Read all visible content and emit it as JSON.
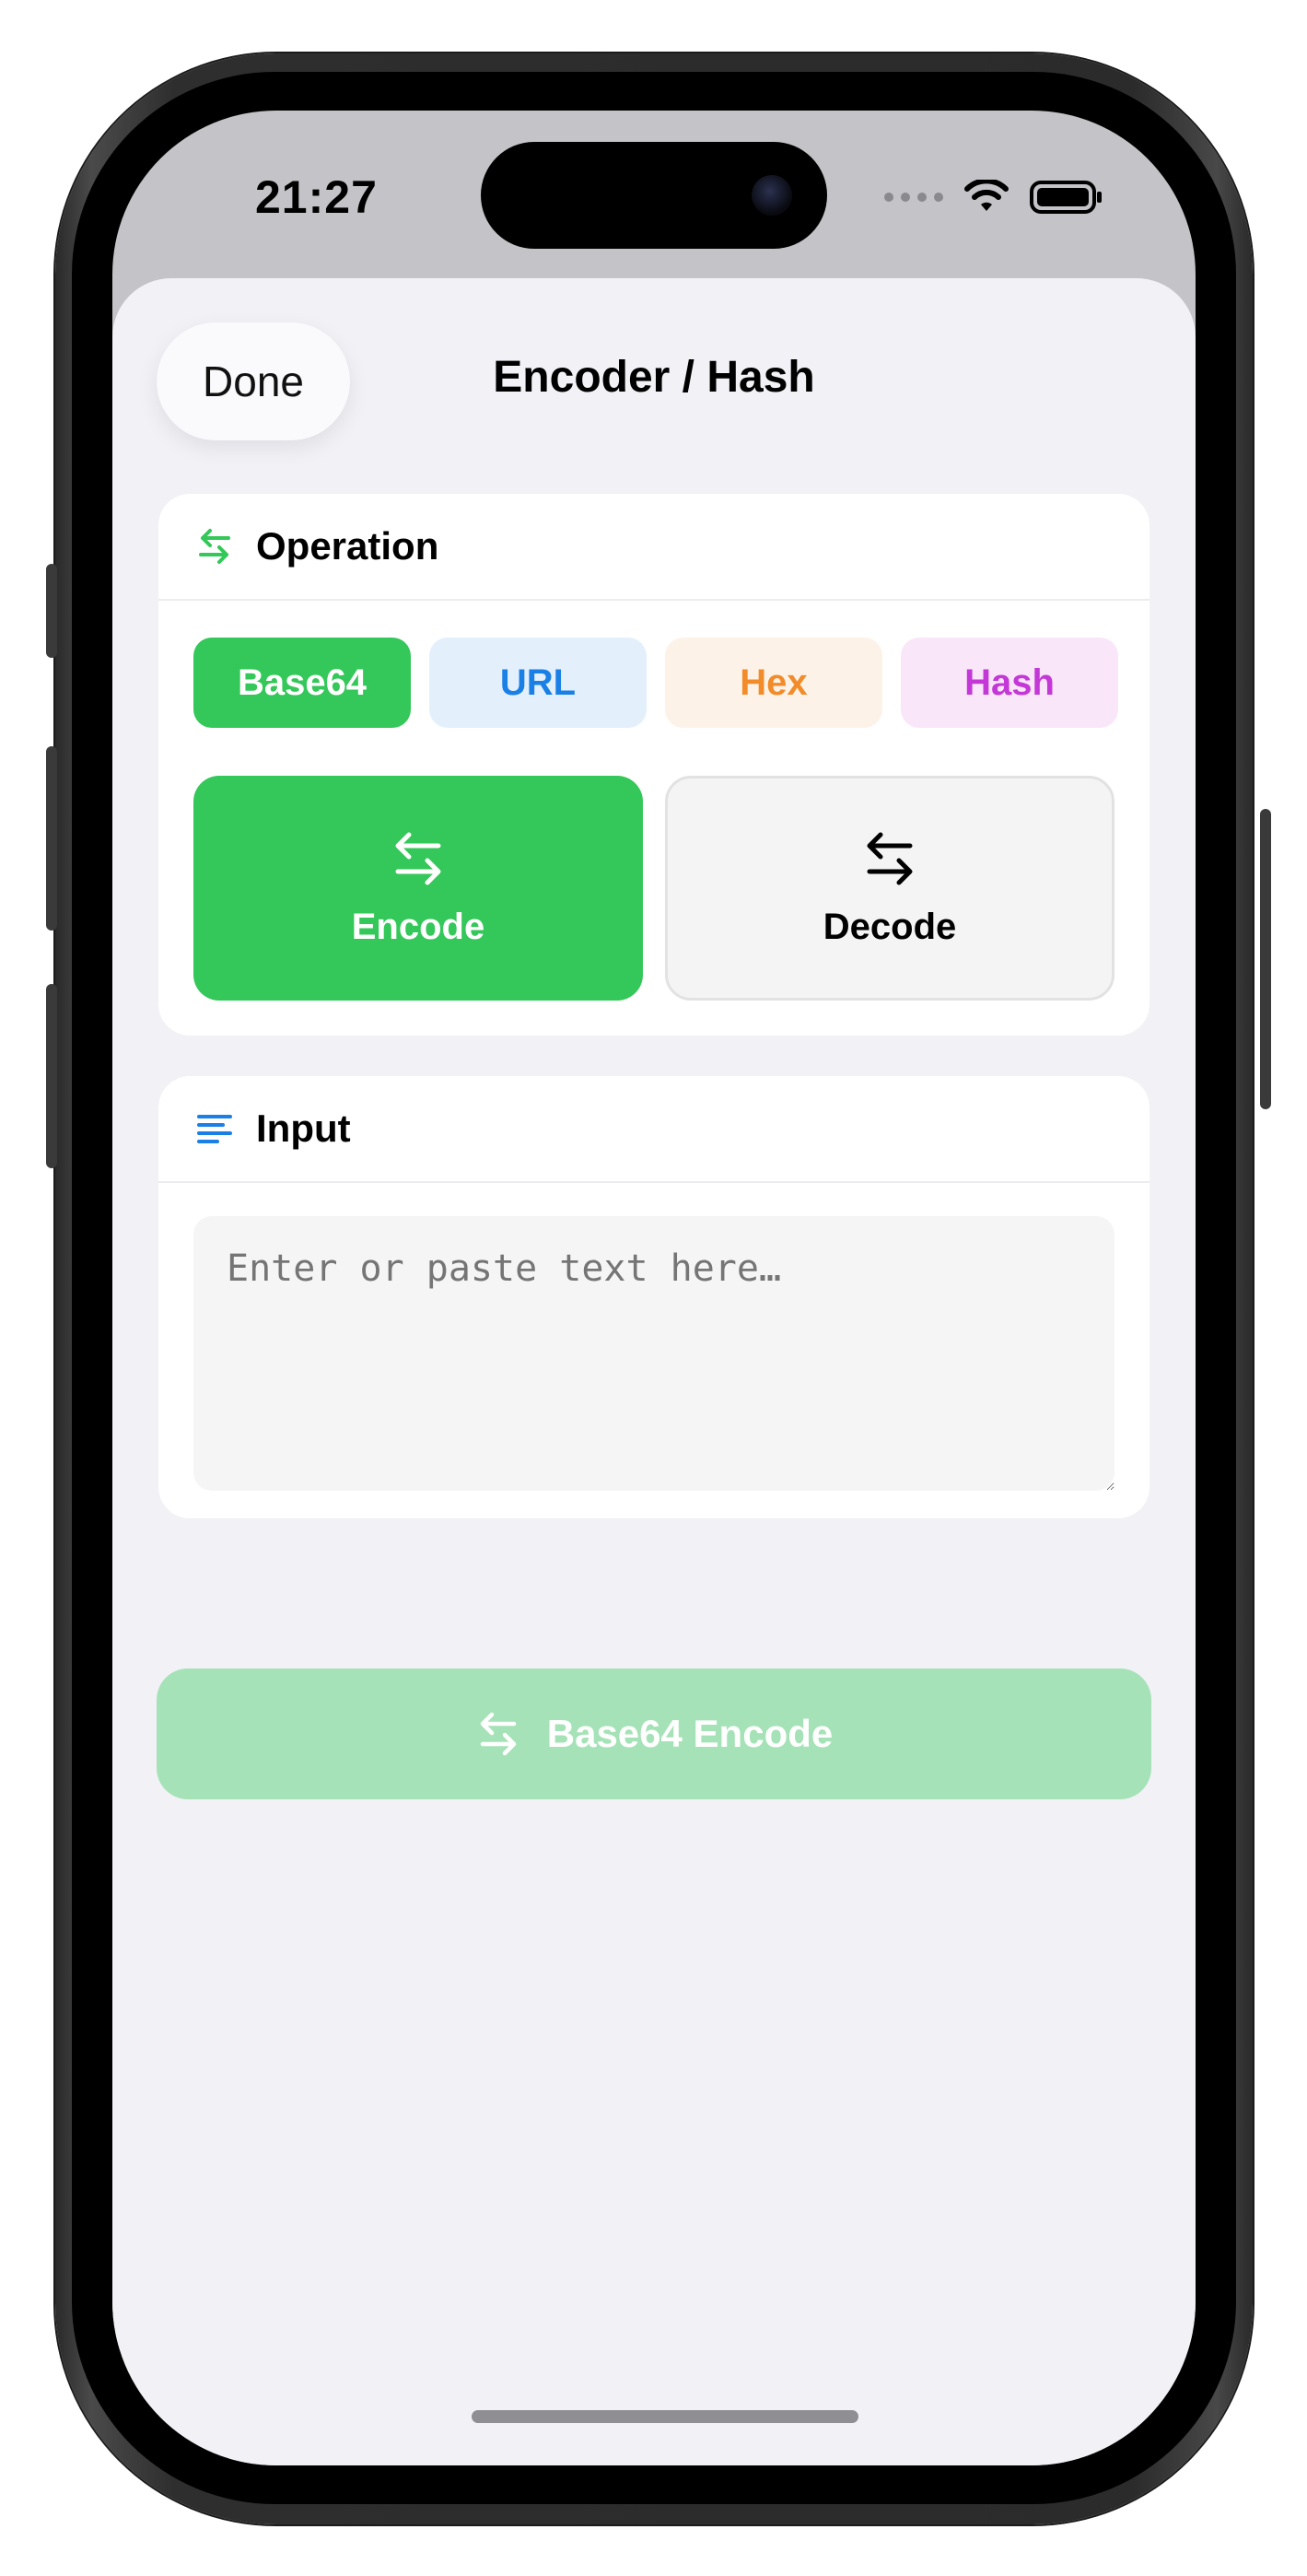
{
  "status_bar": {
    "time": "21:27"
  },
  "sheet": {
    "title": "Encoder / Hash",
    "done_label": "Done"
  },
  "operation": {
    "title": "Operation",
    "tabs": [
      {
        "label": "Base64",
        "selected": true,
        "color": "#34c759"
      },
      {
        "label": "URL",
        "selected": false,
        "color": "#1a80e6"
      },
      {
        "label": "Hex",
        "selected": false,
        "color": "#f28b2a"
      },
      {
        "label": "Hash",
        "selected": false,
        "color": "#c338d6"
      }
    ],
    "encode_label": "Encode",
    "decode_label": "Decode",
    "selected_mode": "Encode"
  },
  "input": {
    "title": "Input",
    "placeholder": "Enter or paste text here…",
    "value": ""
  },
  "action": {
    "label": "Base64 Encode",
    "enabled": false
  },
  "colors": {
    "accent": "#34c759",
    "accent_disabled": "#a6e2b7",
    "background": "#f1f1f6"
  }
}
